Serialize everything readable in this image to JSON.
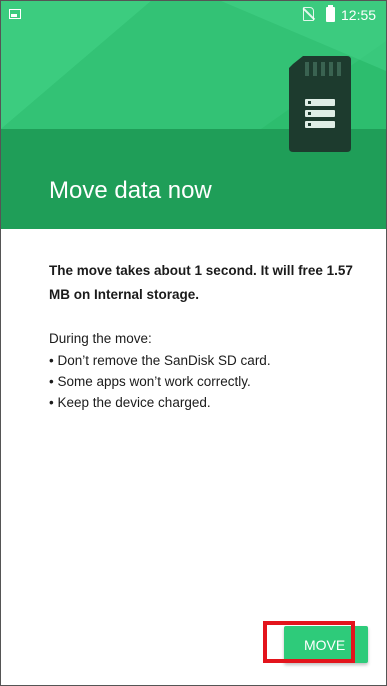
{
  "status_bar": {
    "time": "12:55",
    "icons": [
      "image-notification-icon",
      "no-sim-icon",
      "battery-icon"
    ]
  },
  "header": {
    "title": "Move data now",
    "illustration": "sd-card-icon",
    "color": "#1f9e58"
  },
  "content": {
    "lead": "The move takes about 1 second. It will free 1.57 MB on Internal storage.",
    "during_heading": "During the move:",
    "bullets": [
      "Don’t remove the SanDisk SD card.",
      "Some apps won’t work correctly.",
      "Keep the device charged."
    ]
  },
  "actions": {
    "move_label": "MOVE",
    "button_color": "#2ecb7a",
    "highlight_color": "#e3141c"
  }
}
